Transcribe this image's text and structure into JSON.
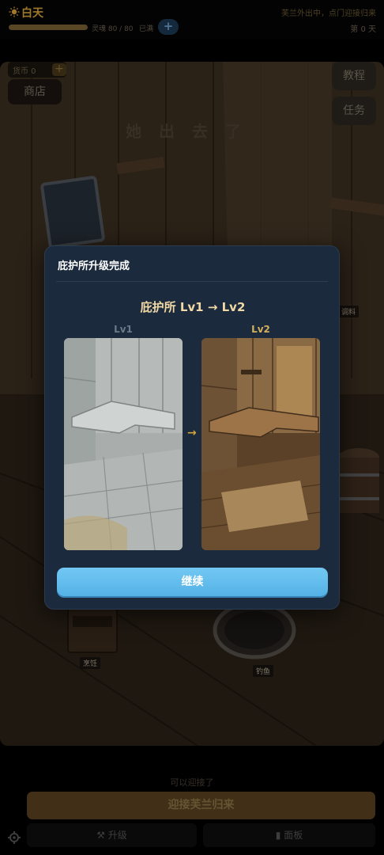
{
  "topbar": {
    "day_label": "白天",
    "status": "芙兰外出中，点门迎接归来",
    "energy_text": "灵魂 80 / 80",
    "energy_fill": 1.0,
    "full_text": "已满",
    "plus": "+",
    "day_count": "第 0 天"
  },
  "scene": {
    "coin_label": "货币 0",
    "coin_plus": "+",
    "shop": "商店",
    "tutorial": "教程",
    "tasks": "任务",
    "caption": "她出去了",
    "label_cooking": "烹饪",
    "label_fishing": "钓鱼",
    "label_seasoning": "调料"
  },
  "modal": {
    "title": "庇护所升级完成",
    "heading": "庇护所 Lv1 → Lv2",
    "lv1": "Lv1",
    "lv2": "Lv2",
    "continue": "继续"
  },
  "bottom": {
    "hint": "可以迎接了",
    "welcome": "迎接芙兰归来",
    "upgrade": "⚒ 升级",
    "panel": "▮ 面板"
  },
  "colors": {
    "accent_blue": "#5fbaea",
    "modal_bg": "#1b2a3c",
    "gold": "#d4b05b"
  }
}
